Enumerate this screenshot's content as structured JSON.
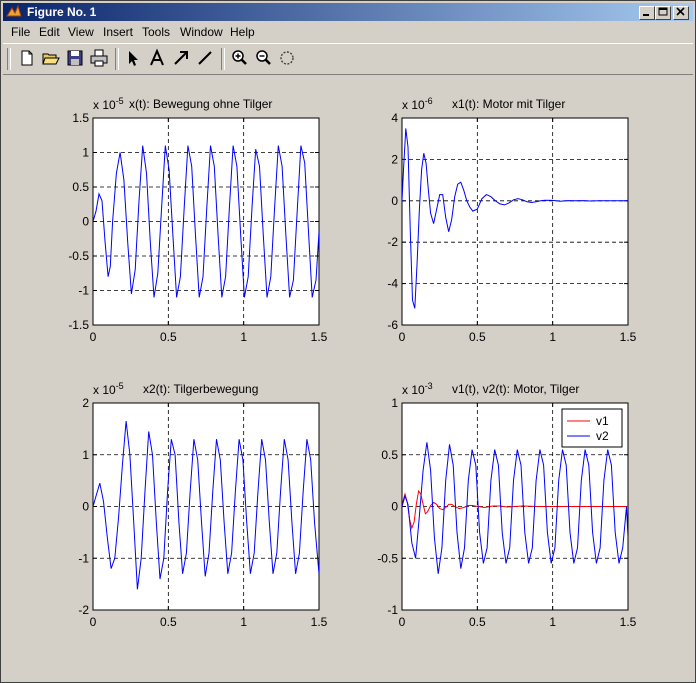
{
  "window": {
    "title": "Figure No. 1"
  },
  "menu": [
    "File",
    "Edit",
    "View",
    "Insert",
    "Tools",
    "Window",
    "Help"
  ],
  "toolbar_icons": [
    "new-file-icon",
    "open-folder-icon",
    "save-icon",
    "print-icon",
    "arrow-pointer-icon",
    "text-a-icon",
    "arrow-icon",
    "line-icon",
    "zoom-in-icon",
    "zoom-out-icon",
    "rotate-icon"
  ],
  "colors": {
    "v1": "#ff0000",
    "v2": "#0000ff",
    "plot_bg": "#ffffff",
    "window_bg": "#d4d0c8"
  },
  "chart_data": [
    {
      "type": "line",
      "title": "x(t): Bewegung ohne Tilger",
      "exponent": "-5",
      "xlim": [
        0,
        1.5
      ],
      "ylim": [
        -1.5,
        1.5
      ],
      "xticks": [
        "0",
        "0.5",
        "1",
        "1.5"
      ],
      "yticks": [
        "-1.5",
        "-1",
        "-0.5",
        "0",
        "0.5",
        "1",
        "1.5"
      ],
      "grid": true,
      "series": [
        {
          "color": "#0000ff",
          "x": [
            0,
            0.02,
            0.04,
            0.06,
            0.08,
            0.1,
            0.115,
            0.13,
            0.155,
            0.18,
            0.205,
            0.23,
            0.255,
            0.28,
            0.305,
            0.33,
            0.355,
            0.38,
            0.405,
            0.43,
            0.455,
            0.48,
            0.505,
            0.53,
            0.555,
            0.58,
            0.605,
            0.63,
            0.655,
            0.68,
            0.705,
            0.73,
            0.755,
            0.78,
            0.805,
            0.83,
            0.855,
            0.88,
            0.905,
            0.93,
            0.955,
            0.98,
            1.005,
            1.03,
            1.055,
            1.08,
            1.105,
            1.13,
            1.155,
            1.18,
            1.205,
            1.23,
            1.255,
            1.28,
            1.305,
            1.33,
            1.355,
            1.38,
            1.405,
            1.43,
            1.455,
            1.48,
            1.5
          ],
          "y": [
            0,
            0.15,
            0.4,
            0.3,
            -0.3,
            -0.8,
            -0.65,
            0,
            0.7,
            1.0,
            0.6,
            -0.3,
            -1.05,
            -0.7,
            0.3,
            1.1,
            0.7,
            -0.3,
            -1.1,
            -0.75,
            0.2,
            1.1,
            0.75,
            -0.2,
            -1.1,
            -0.8,
            0.2,
            1.1,
            0.8,
            -0.2,
            -1.1,
            -0.8,
            0.2,
            1.1,
            0.8,
            -0.2,
            -1.1,
            -0.8,
            0.2,
            1.1,
            0.8,
            -0.2,
            -1.1,
            -0.8,
            0.2,
            1.05,
            0.8,
            -0.2,
            -1.1,
            -0.8,
            0.2,
            1.1,
            0.8,
            -0.2,
            -1.1,
            -0.85,
            0.15,
            1.1,
            0.85,
            -0.15,
            -1.1,
            -0.85,
            -0.15
          ]
        }
      ]
    },
    {
      "type": "line",
      "title": "x1(t): Motor mit Tilger",
      "exponent": "-6",
      "xlim": [
        0,
        1.5
      ],
      "ylim": [
        -6,
        4
      ],
      "xticks": [
        "0",
        "0.5",
        "1",
        "1.5"
      ],
      "yticks": [
        "-6",
        "-4",
        "-2",
        "0",
        "2",
        "4"
      ],
      "grid": true,
      "series": [
        {
          "color": "#0000ff",
          "x": [
            0,
            0.01,
            0.025,
            0.04,
            0.055,
            0.07,
            0.085,
            0.1,
            0.115,
            0.13,
            0.145,
            0.16,
            0.175,
            0.19,
            0.21,
            0.23,
            0.25,
            0.27,
            0.29,
            0.31,
            0.33,
            0.35,
            0.37,
            0.39,
            0.41,
            0.43,
            0.45,
            0.47,
            0.5,
            0.53,
            0.56,
            0.59,
            0.62,
            0.65,
            0.68,
            0.71,
            0.74,
            0.77,
            0.8,
            0.83,
            0.86,
            0.89,
            0.92,
            0.95,
            1.0,
            1.05,
            1.1,
            1.15,
            1.2,
            1.25,
            1.3,
            1.35,
            1.4,
            1.45,
            1.5
          ],
          "y": [
            0,
            1.5,
            3.5,
            2.6,
            -1.5,
            -4.8,
            -5.2,
            -3.0,
            -0.5,
            1.5,
            2.3,
            1.8,
            0.5,
            -0.6,
            -1.1,
            -0.4,
            0.3,
            0.3,
            -0.8,
            -1.5,
            -0.9,
            0.2,
            0.8,
            0.9,
            0.5,
            0.0,
            -0.3,
            -0.5,
            -0.4,
            0.1,
            0.3,
            0.2,
            0.0,
            -0.15,
            -0.2,
            -0.1,
            0.05,
            0.1,
            0.05,
            -0.05,
            -0.08,
            -0.05,
            0.0,
            0.03,
            0.02,
            -0.02,
            0.01,
            0.0,
            0.01,
            -0.01,
            0.0,
            0.0,
            0.0,
            0.0,
            0.0
          ]
        }
      ]
    },
    {
      "type": "line",
      "title": "x2(t): Tilgerbewegung",
      "exponent": "-5",
      "xlim": [
        0,
        1.5
      ],
      "ylim": [
        -2,
        2
      ],
      "xticks": [
        "0",
        "0.5",
        "1",
        "1.5"
      ],
      "yticks": [
        "-2",
        "-1",
        "0",
        "1",
        "2"
      ],
      "grid": true,
      "series": [
        {
          "color": "#0000ff",
          "x": [
            0,
            0.02,
            0.045,
            0.07,
            0.095,
            0.12,
            0.145,
            0.17,
            0.195,
            0.22,
            0.245,
            0.27,
            0.295,
            0.32,
            0.345,
            0.37,
            0.395,
            0.42,
            0.445,
            0.47,
            0.495,
            0.52,
            0.545,
            0.57,
            0.595,
            0.62,
            0.645,
            0.67,
            0.695,
            0.72,
            0.745,
            0.77,
            0.795,
            0.82,
            0.845,
            0.87,
            0.895,
            0.92,
            0.945,
            0.97,
            0.995,
            1.02,
            1.045,
            1.07,
            1.095,
            1.12,
            1.145,
            1.17,
            1.195,
            1.22,
            1.245,
            1.27,
            1.295,
            1.32,
            1.345,
            1.37,
            1.395,
            1.42,
            1.445,
            1.47,
            1.5
          ],
          "y": [
            0,
            0.2,
            0.45,
            0.1,
            -0.6,
            -1.2,
            -1.0,
            -0.2,
            0.8,
            1.65,
            1.0,
            -0.3,
            -1.6,
            -1.0,
            0.3,
            1.45,
            1.0,
            -0.3,
            -1.4,
            -1.0,
            0.3,
            1.3,
            1.0,
            -0.3,
            -1.3,
            -0.9,
            0.3,
            1.3,
            0.9,
            -0.3,
            -1.35,
            -0.9,
            0.3,
            1.3,
            0.9,
            -0.3,
            -1.3,
            -0.9,
            0.3,
            1.3,
            0.9,
            -0.3,
            -1.3,
            -0.9,
            0.3,
            1.3,
            0.9,
            -0.3,
            -1.3,
            -0.9,
            0.3,
            1.3,
            0.9,
            -0.3,
            -1.3,
            -0.9,
            0.3,
            1.3,
            0.9,
            -0.3,
            -1.3
          ]
        }
      ]
    },
    {
      "type": "line",
      "title": "v1(t), v2(t): Motor, Tilger",
      "exponent": "-3",
      "xlim": [
        0,
        1.5
      ],
      "ylim": [
        -1,
        1
      ],
      "xticks": [
        "0",
        "0.5",
        "1",
        "1.5"
      ],
      "yticks": [
        "-1",
        "-0.5",
        "0",
        "0.5",
        "1"
      ],
      "grid": true,
      "legend": {
        "placement": "top-right",
        "entries": [
          "v1",
          "v2"
        ]
      },
      "series": [
        {
          "name": "v1",
          "color": "#ff0000",
          "x": [
            0,
            0.01,
            0.02,
            0.035,
            0.05,
            0.065,
            0.08,
            0.095,
            0.11,
            0.125,
            0.14,
            0.155,
            0.17,
            0.19,
            0.21,
            0.23,
            0.25,
            0.27,
            0.29,
            0.31,
            0.33,
            0.35,
            0.38,
            0.41,
            0.44,
            0.47,
            0.5,
            0.55,
            0.6,
            0.65,
            0.7,
            0.75,
            0.8,
            0.9,
            1.0,
            1.1,
            1.2,
            1.3,
            1.4,
            1.5
          ],
          "y": [
            0,
            0.07,
            0.12,
            0.04,
            -0.12,
            -0.21,
            -0.15,
            0.02,
            0.15,
            0.12,
            0.02,
            -0.07,
            -0.05,
            0.01,
            0.04,
            0.02,
            -0.02,
            -0.03,
            -0.01,
            0.02,
            0.02,
            0.0,
            -0.02,
            -0.01,
            0.01,
            0.01,
            0.0,
            -0.01,
            0.005,
            0.005,
            -0.005,
            0.0,
            0.005,
            0.0,
            0.0,
            0.0,
            0.0,
            0.0,
            0.0,
            0.0
          ]
        },
        {
          "name": "v2",
          "color": "#0000ff",
          "x": [
            0,
            0.02,
            0.04,
            0.065,
            0.09,
            0.115,
            0.14,
            0.165,
            0.19,
            0.215,
            0.24,
            0.265,
            0.29,
            0.315,
            0.34,
            0.365,
            0.39,
            0.415,
            0.44,
            0.465,
            0.49,
            0.515,
            0.54,
            0.565,
            0.59,
            0.615,
            0.64,
            0.665,
            0.69,
            0.715,
            0.74,
            0.765,
            0.79,
            0.815,
            0.84,
            0.865,
            0.89,
            0.915,
            0.94,
            0.965,
            0.99,
            1.015,
            1.04,
            1.065,
            1.09,
            1.115,
            1.14,
            1.165,
            1.19,
            1.215,
            1.24,
            1.265,
            1.29,
            1.315,
            1.34,
            1.365,
            1.39,
            1.415,
            1.44,
            1.465,
            1.49,
            1.5
          ],
          "y": [
            0,
            0.1,
            0.02,
            -0.35,
            -0.5,
            -0.1,
            0.35,
            0.62,
            0.35,
            -0.3,
            -0.65,
            -0.4,
            0.25,
            0.6,
            0.4,
            -0.25,
            -0.6,
            -0.4,
            0.25,
            0.55,
            0.4,
            -0.25,
            -0.55,
            -0.4,
            0.25,
            0.55,
            0.4,
            -0.25,
            -0.55,
            -0.4,
            0.25,
            0.55,
            0.4,
            -0.25,
            -0.55,
            -0.4,
            0.25,
            0.55,
            0.4,
            -0.25,
            -0.55,
            -0.4,
            0.25,
            0.55,
            0.4,
            -0.25,
            -0.55,
            -0.4,
            0.25,
            0.55,
            0.4,
            -0.25,
            -0.55,
            -0.4,
            0.25,
            0.55,
            0.4,
            -0.25,
            -0.55,
            -0.4,
            0.0,
            -0.3
          ]
        }
      ]
    }
  ]
}
